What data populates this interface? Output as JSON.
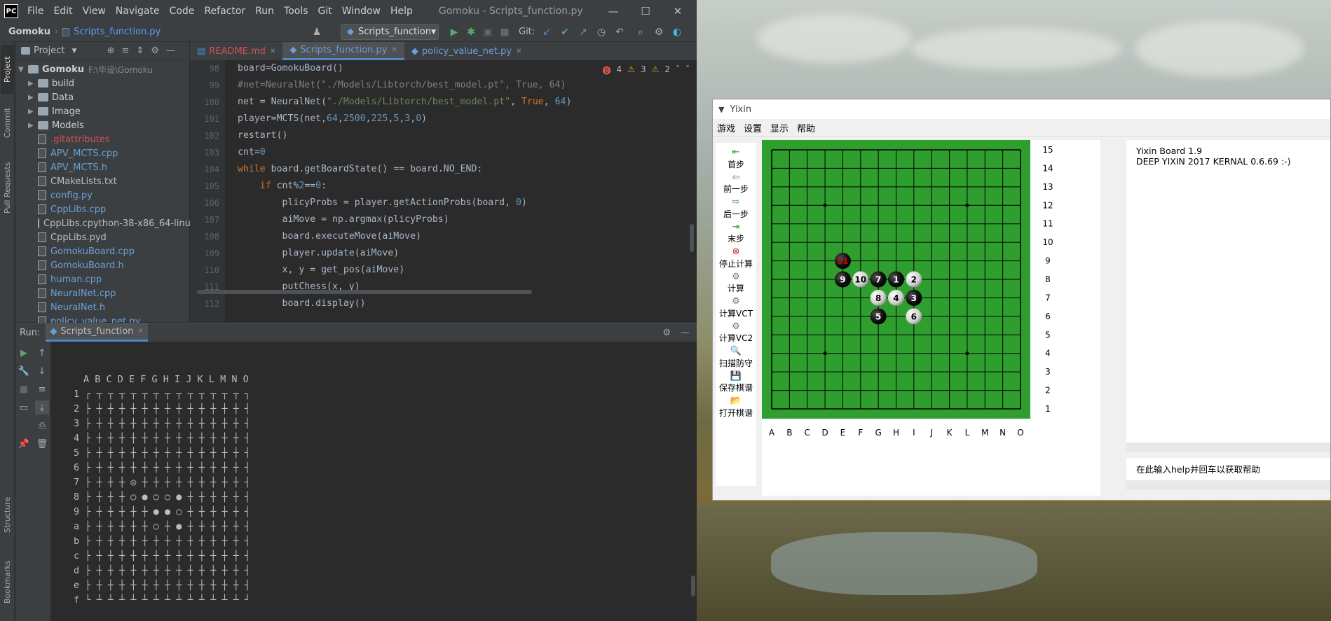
{
  "ide": {
    "title": "Gomoku - Scripts_function.py",
    "logo": "PC",
    "menu": [
      "File",
      "Edit",
      "View",
      "Navigate",
      "Code",
      "Refactor",
      "Run",
      "Tools",
      "Git",
      "Window",
      "Help"
    ],
    "nav": {
      "project": "Gomoku",
      "file": "Scripts_function.py",
      "run_config": "Scripts_function",
      "git_label": "Git:"
    },
    "side_tabs": {
      "project": "Project",
      "commit": "Commit",
      "pull_requests": "Pull Requests",
      "structure": "Structure",
      "bookmarks": "Bookmarks"
    },
    "project_panel": {
      "title": "Project",
      "root": "Gomoku",
      "root_path": "F:\\毕设\\Gomoku",
      "folders": [
        "build",
        "Data",
        "Image",
        "Models"
      ],
      "files": [
        ".gitattributes",
        "APV_MCTS.cpp",
        "APV_MCTS.h",
        "CMakeLists.txt",
        "config.py",
        "CppLibs.cpp",
        "CppLibs.cpython-38-x86_64-linu",
        "CppLibs.pyd",
        "GomokuBoard.cpp",
        "GomokuBoard.h",
        "human.cpp",
        "NeuralNet.cpp",
        "NeuralNet.h",
        "policy_value_net.py"
      ]
    },
    "tabs": [
      "README.md",
      "Scripts_function.py",
      "policy_value_net.py"
    ],
    "inspections": {
      "errors": "4",
      "warnings": "3",
      "weak": "2"
    },
    "line_numbers": [
      "98",
      "99",
      "100",
      "101",
      "102",
      "103",
      "104",
      "105",
      "106",
      "107",
      "108",
      "109",
      "110",
      "111",
      "112"
    ],
    "code_lines": [
      "board=GomokuBoard()",
      "#net=NeuralNet(\"./Models/Libtorch/best_model.pt\", True, 64)",
      "net = NeuralNet(\"./Models/Libtorch/best_model.pt\", True, 64)",
      "player=MCTS(net,64,2500,225,5,3,0)",
      "restart()",
      "cnt=0",
      "while board.getBoardState() == board.NO_END:",
      "    if cnt%2==0:",
      "        plicyProbs = player.getActionProbs(board, 0)",
      "        aiMove = np.argmax(plicyProbs)",
      "        board.executeMove(aiMove)",
      "        player.update(aiMove)",
      "        x, y = get_pos(aiMove)",
      "        putChess(x, y)",
      "        board.display()"
    ],
    "run": {
      "label": "Run:",
      "tab": "Scripts_function",
      "header": "A B C D E F G H I J K L M N O",
      "rows": [
        "1 ┌ ┬ ┬ ┬ ┬ ┬ ┬ ┬ ┬ ┬ ┬ ┬ ┬ ┬ ┐",
        "2 ├ ┼ ┼ ┼ ┼ ┼ ┼ ┼ ┼ ┼ ┼ ┼ ┼ ┼ ┤",
        "3 ├ ┼ ┼ ┼ ┼ ┼ ┼ ┼ ┼ ┼ ┼ ┼ ┼ ┼ ┤",
        "4 ├ ┼ ┼ ┼ ┼ ┼ ┼ ┼ ┼ ┼ ┼ ┼ ┼ ┼ ┤",
        "5 ├ ┼ ┼ ┼ ┼ ┼ ┼ ┼ ┼ ┼ ┼ ┼ ┼ ┼ ┤",
        "6 ├ ┼ ┼ ┼ ┼ ┼ ┼ ┼ ┼ ┼ ┼ ┼ ┼ ┼ ┤",
        "7 ├ ┼ ┼ ┼ ◎ ┼ ┼ ┼ ┼ ┼ ┼ ┼ ┼ ┼ ┤",
        "8 ├ ┼ ┼ ┼ ○ ● ○ ○ ● ┼ ┼ ┼ ┼ ┼ ┤",
        "9 ├ ┼ ┼ ┼ ┼ ┼ ● ● ○ ┼ ┼ ┼ ┼ ┼ ┤",
        "a ├ ┼ ┼ ┼ ┼ ┼ ○ ┼ ● ┼ ┼ ┼ ┼ ┼ ┤",
        "b ├ ┼ ┼ ┼ ┼ ┼ ┼ ┼ ┼ ┼ ┼ ┼ ┼ ┼ ┤",
        "c ├ ┼ ┼ ┼ ┼ ┼ ┼ ┼ ┼ ┼ ┼ ┼ ┼ ┼ ┤",
        "d ├ ┼ ┼ ┼ ┼ ┼ ┼ ┼ ┼ ┼ ┼ ┼ ┼ ┼ ┤",
        "e ├ ┼ ┼ ┼ ┼ ┼ ┼ ┼ ┼ ┼ ┼ ┼ ┼ ┼ ┤",
        "f └ ┴ ┴ ┴ ┴ ┴ ┴ ┴ ┴ ┴ ┴ ┴ ┴ ┴ ┘"
      ]
    }
  },
  "yixin": {
    "title": "Yixin",
    "menu": [
      "游戏",
      "设置",
      "显示",
      "帮助"
    ],
    "tools": [
      {
        "label": "首步",
        "icon": "first-move-icon"
      },
      {
        "label": "前一步",
        "icon": "prev-move-icon"
      },
      {
        "label": "后一步",
        "icon": "next-move-icon"
      },
      {
        "label": "末步",
        "icon": "last-move-icon"
      },
      {
        "label": "停止计算",
        "icon": "stop-icon"
      },
      {
        "label": "计算",
        "icon": "compute-icon"
      },
      {
        "label": "计算VCT",
        "icon": "compute-vct-icon"
      },
      {
        "label": "计算VC2",
        "icon": "compute-vc2-icon"
      },
      {
        "label": "扫描防守",
        "icon": "scan-icon"
      },
      {
        "label": "保存棋谱",
        "icon": "save-icon"
      },
      {
        "label": "打开棋谱",
        "icon": "open-icon"
      }
    ],
    "cols": [
      "A",
      "B",
      "C",
      "D",
      "E",
      "F",
      "G",
      "H",
      "I",
      "J",
      "K",
      "L",
      "M",
      "N",
      "O"
    ],
    "rows": [
      "15",
      "14",
      "13",
      "12",
      "11",
      "10",
      "9",
      "8",
      "7",
      "6",
      "5",
      "4",
      "3",
      "2",
      "1"
    ],
    "stones": [
      {
        "n": "1",
        "col": "H",
        "row": "8",
        "color": "black"
      },
      {
        "n": "2",
        "col": "I",
        "row": "8",
        "color": "white"
      },
      {
        "n": "3",
        "col": "I",
        "row": "7",
        "color": "black"
      },
      {
        "n": "4",
        "col": "H",
        "row": "7",
        "color": "white"
      },
      {
        "n": "5",
        "col": "G",
        "row": "6",
        "color": "black"
      },
      {
        "n": "6",
        "col": "I",
        "row": "6",
        "color": "white"
      },
      {
        "n": "7",
        "col": "G",
        "row": "8",
        "color": "black"
      },
      {
        "n": "8",
        "col": "G",
        "row": "7",
        "color": "white"
      },
      {
        "n": "9",
        "col": "E",
        "row": "8",
        "color": "black"
      },
      {
        "n": "10",
        "col": "F",
        "row": "8",
        "color": "white"
      },
      {
        "n": "11",
        "col": "E",
        "row": "9",
        "color": "black",
        "last": true
      }
    ],
    "star_points": [
      [
        "D",
        "12"
      ],
      [
        "L",
        "12"
      ],
      [
        "D",
        "4"
      ],
      [
        "L",
        "4"
      ]
    ],
    "log": [
      "Yixin Board 1.9",
      "DEEP YIXIN 2017 KERNAL 0.6.69 :-)"
    ],
    "input_hint": "在此输入help并回车以获取帮助",
    "colors": {
      "board": "#2e9e2e",
      "last_move": "#cc0000"
    }
  }
}
